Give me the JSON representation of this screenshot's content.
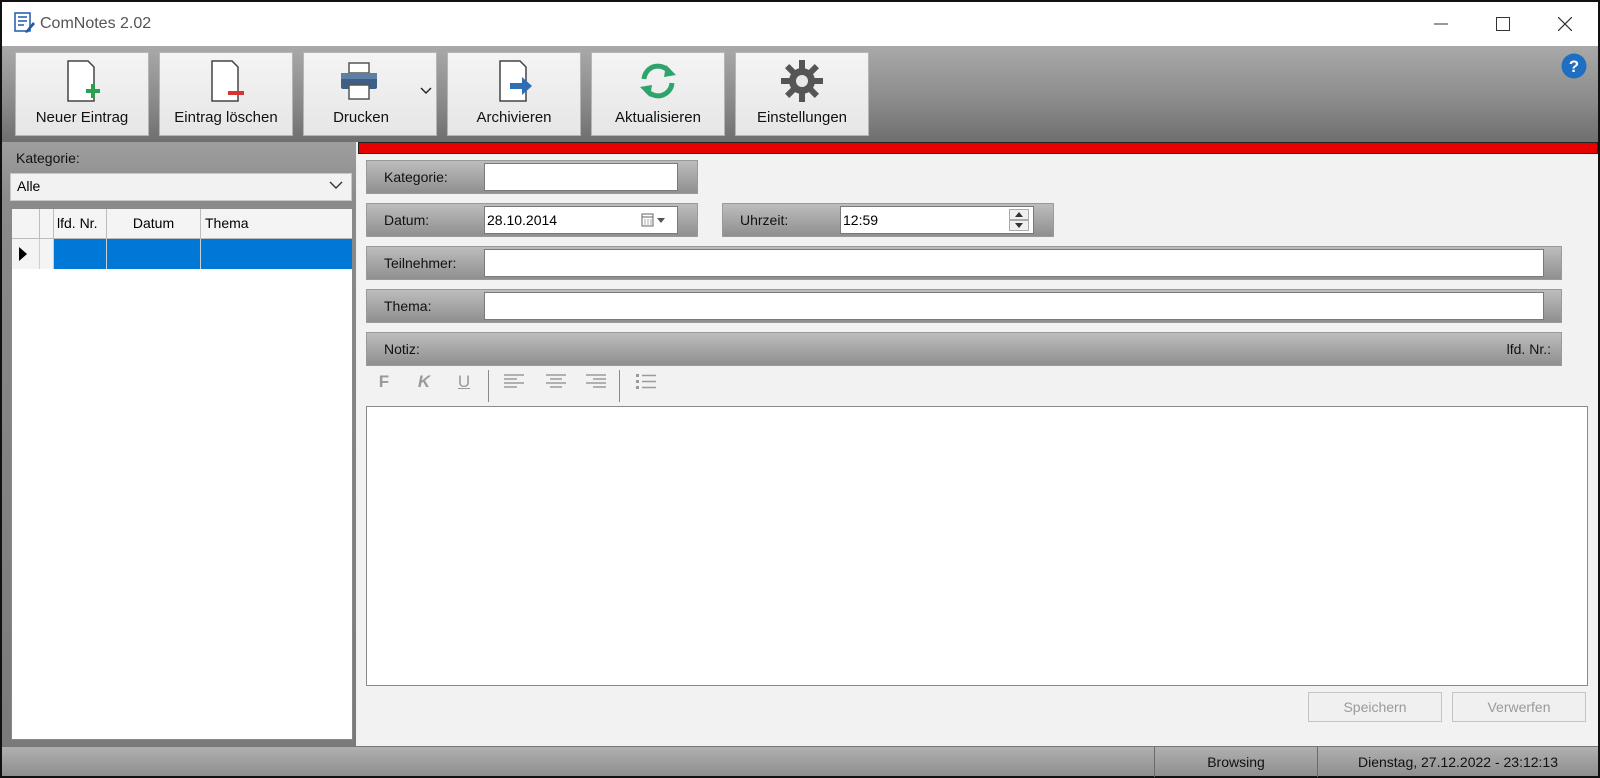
{
  "window": {
    "title": "ComNotes 2.02"
  },
  "toolbar": {
    "new_entry": "Neuer Eintrag",
    "delete_entry": "Eintrag löschen",
    "print": "Drucken",
    "archive": "Archivieren",
    "refresh": "Aktualisieren",
    "settings": "Einstellungen"
  },
  "left": {
    "category_label": "Kategorie:",
    "category_selected": "Alle",
    "grid": {
      "columns": [
        "lfd. Nr.",
        "Datum",
        "Thema"
      ],
      "rows": [
        [
          "",
          "",
          ""
        ]
      ]
    }
  },
  "form": {
    "category_label": "Kategorie:",
    "category_value": "",
    "date_label": "Datum:",
    "date_value": "28.10.2014",
    "time_label": "Uhrzeit:",
    "time_value": "12:59",
    "participants_label": "Teilnehmer:",
    "participants_value": "",
    "topic_label": "Thema:",
    "topic_value": "",
    "note_label": "Notiz:",
    "number_label": "lfd. Nr.:",
    "note_value": ""
  },
  "rte": {
    "bold": "F",
    "italic": "K",
    "underline": "U"
  },
  "buttons": {
    "save": "Speichern",
    "discard": "Verwerfen"
  },
  "status": {
    "mode": "Browsing",
    "datetime": "Dienstag, 27.12.2022 - 23:12:13"
  },
  "colors": {
    "accent": "#e60000",
    "selection": "#0078d7",
    "help": "#1e6fc1"
  }
}
